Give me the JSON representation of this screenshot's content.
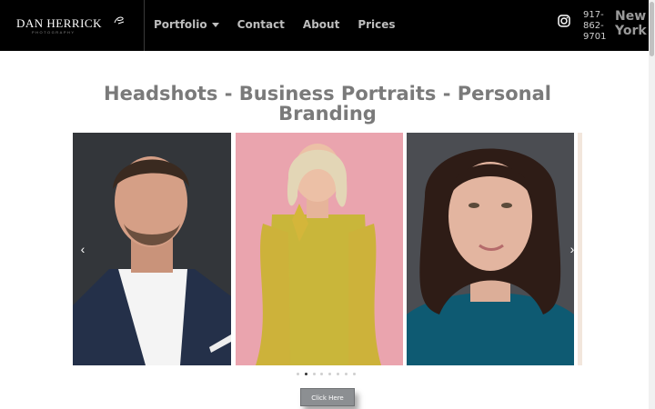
{
  "header": {
    "logo_main": "DAN HERRICK",
    "logo_sub": "PHOTOGRAPHY",
    "nav": [
      {
        "label": "Portfolio",
        "has_dropdown": true
      },
      {
        "label": "Contact"
      },
      {
        "label": "About"
      },
      {
        "label": "Prices"
      }
    ],
    "phone_lines": [
      "917-",
      "862-",
      "9701"
    ],
    "city_lines": [
      "New",
      "York"
    ]
  },
  "main": {
    "title": "Headshots - Business Portraits - Personal Branding",
    "carousel": {
      "active_dot": 1,
      "dot_count": 8,
      "prev_icon": "chevron-left-icon",
      "next_icon": "chevron-right-icon"
    },
    "cta_label": "Click Here"
  },
  "colors": {
    "header_bg": "#000000",
    "title": "#7a7a7a",
    "button": "#8c8f92"
  }
}
